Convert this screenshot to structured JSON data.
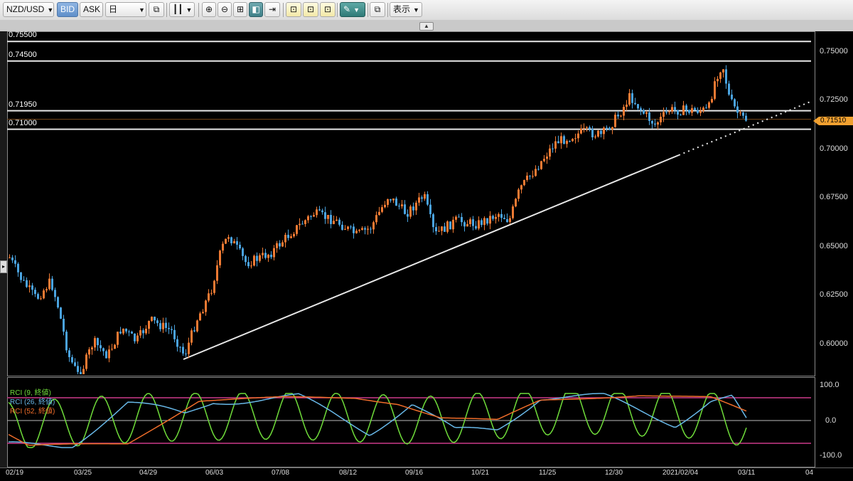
{
  "toolbar": {
    "pair": "NZD/USD",
    "bid": "BID",
    "ask": "ASK",
    "timeframe": "日",
    "display": "表示"
  },
  "price_axis": {
    "ticks": [
      "0.75000",
      "0.72500",
      "0.70000",
      "0.67500",
      "0.65000",
      "0.62500",
      "0.60000"
    ],
    "current_price": "0.71510"
  },
  "horizontal_lines": [
    "0.75500",
    "0.74500",
    "0.71950",
    "0.71000"
  ],
  "rci": {
    "legend": [
      "RCI (9, 終値)",
      "RCI (26, 終値)",
      "RCI (52, 終値)"
    ],
    "axis": [
      "100.0",
      "0.0",
      "-100.0"
    ]
  },
  "x_axis": [
    "02/19",
    "03/25",
    "04/29",
    "06/03",
    "07/08",
    "08/12",
    "09/16",
    "10/21",
    "11/25",
    "12/30",
    "2021/02/04",
    "03/11",
    "04"
  ],
  "colors": {
    "up": "#f07a33",
    "down": "#4aa3df",
    "rci9": "#6fdc3a",
    "rci26": "#68b8e8",
    "rci52": "#ef6d2a",
    "band": "#cc3b8a"
  },
  "chart_data": [
    {
      "type": "line",
      "note": "NZD/USD daily candlestick",
      "x": [
        "02/19",
        "03/25",
        "04/29",
        "06/03",
        "07/08",
        "08/12",
        "09/16",
        "10/21",
        "11/25",
        "12/30",
        "2021/02/04",
        "03/11"
      ],
      "y": [
        0.64,
        0.605,
        0.598,
        0.65,
        0.665,
        0.67,
        0.665,
        0.665,
        0.705,
        0.72,
        0.725,
        0.7151
      ],
      "ylim": [
        0.585,
        0.755
      ]
    },
    {
      "type": "line",
      "series": [
        {
          "name": "RCI (9, 終値)"
        },
        {
          "name": "RCI (26, 終値)"
        },
        {
          "name": "RCI (52, 終値)"
        }
      ],
      "ylim": [
        -100,
        100
      ]
    }
  ]
}
